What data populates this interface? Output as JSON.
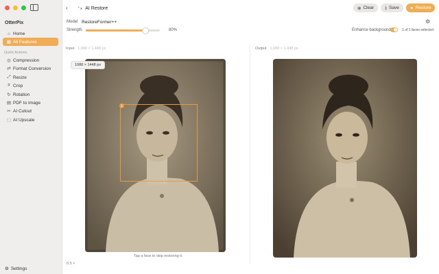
{
  "window": {
    "colors": {
      "close": "#fe5f57",
      "minimize": "#febc2e",
      "zoom": "#28c840",
      "accent": "#f0ad55"
    }
  },
  "sidebar": {
    "app_name": "OtterPix",
    "items": [
      {
        "label": "Home",
        "icon": "home-icon",
        "glyph": "⌂"
      },
      {
        "label": "All Features",
        "icon": "grid-icon",
        "glyph": "▦"
      }
    ],
    "section_label": "Quick Actions",
    "quick_actions": [
      {
        "label": "Compression",
        "icon": "compress-icon",
        "glyph": "◎"
      },
      {
        "label": "Format Conversion",
        "icon": "convert-icon",
        "glyph": "⇄"
      },
      {
        "label": "Resize",
        "icon": "resize-icon",
        "glyph": "⤢"
      },
      {
        "label": "Crop",
        "icon": "crop-icon",
        "glyph": "⌗"
      },
      {
        "label": "Rotation",
        "icon": "rotate-icon",
        "glyph": "↻"
      },
      {
        "label": "PDF to Image",
        "icon": "pdf-icon",
        "glyph": "▤"
      },
      {
        "label": "AI Cutout",
        "icon": "cutout-icon",
        "glyph": "✂"
      },
      {
        "label": "AI Upscale",
        "icon": "upscale-icon",
        "glyph": "⬚"
      }
    ],
    "settings_label": "Settings"
  },
  "toolbar": {
    "title": "AI Restore",
    "clear_label": "Clear",
    "save_label": "Save",
    "restore_label": "Restore"
  },
  "controls": {
    "model_label": "Model",
    "model_value": "RestoreFormer++",
    "strength_label": "Strength",
    "strength_value": "80%",
    "strength_fraction": 0.8,
    "enhance_label": "Enhance background",
    "enhance_on": true,
    "faces_selected": "1 of 1 faces selected"
  },
  "panes": {
    "input_label": "Input",
    "input_dims": "1,088 × 1,448 px",
    "output_label": "Output",
    "output_dims": "1,088 × 1,448 px",
    "size_pill": "1088 × 1448 px",
    "face_number": "1",
    "hint": "Tap a face to skip restoring it.",
    "zoom": "0.5 ×"
  }
}
